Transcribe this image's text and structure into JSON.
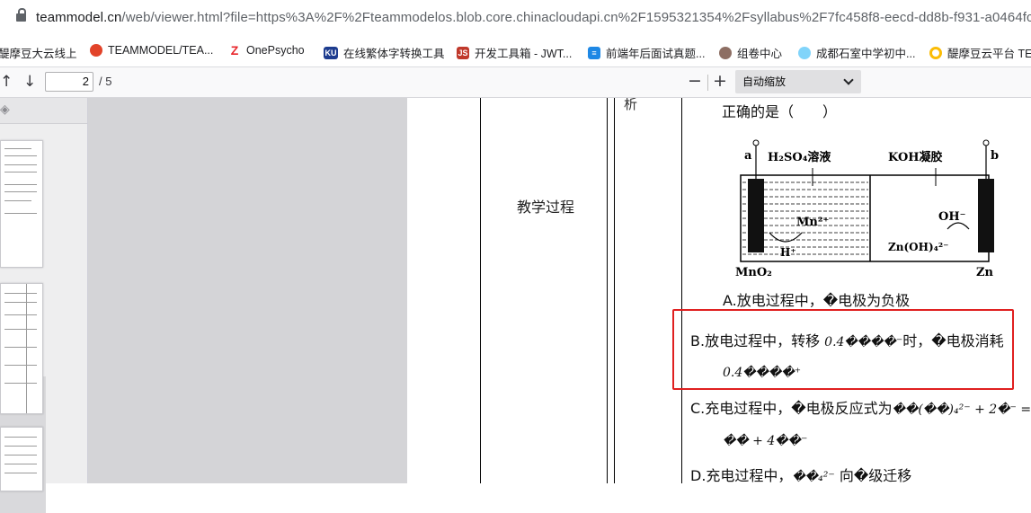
{
  "browser": {
    "url_host": "teammodel.cn",
    "url_rest": "/web/viewer.html?file=https%3A%2F%2Fteammodelos.blob.core.chinacloudapi.cn%2F1595321354%2Fsyllabus%2F7fc458f8-eecd-dd8b-f931-a0464fca1"
  },
  "bookmarks": [
    {
      "label": "醍摩豆大云线上",
      "icon": "",
      "color": "#1a73e8"
    },
    {
      "label": "TEAMMODEL/TEA...",
      "icon": "gitlab-icon",
      "color": "#e24329"
    },
    {
      "label": "OnePsycho",
      "icon": "z-logo-icon",
      "color": "#e8272c"
    },
    {
      "label": "在线繁体字转换工具",
      "icon": "KU",
      "color": "#1d3c8f"
    },
    {
      "label": "开发工具箱 - JWT...",
      "icon": "JS",
      "color": "#c0392b"
    },
    {
      "label": "前端年后面试真题...",
      "icon": "list-icon",
      "color": "#1e88e5"
    },
    {
      "label": "组卷中心",
      "icon": "owl-icon",
      "color": "#795548"
    },
    {
      "label": "成都石室中学初中...",
      "icon": "cloud-icon",
      "color": "#4fc3f7"
    },
    {
      "label": "醍摩豆云平台 TE",
      "icon": "ring-icon",
      "color": "#fbbc05"
    }
  ],
  "pdf": {
    "page_current": "2",
    "page_total": "/ 5",
    "zoom_label": "自动缩放"
  },
  "document": {
    "row_label": "教学过程",
    "col_fragment": "析",
    "question_tail": "正确的是（　　）",
    "diagram": {
      "a": "a",
      "b": "b",
      "left_solution": "H₂SO₄溶液",
      "right_solution": "KOH凝胶",
      "mn_ion": "Mn²⁺",
      "h_ion": "H⁺",
      "oh_ion": "OH⁻",
      "zn_complex": "Zn(OH)₄²⁻",
      "left_electrode": "MnO₂",
      "right_electrode": "Zn"
    },
    "option_a": "A.放电过程中，�电极为负极",
    "option_b_1": "B.放电过程中，转移",
    "option_b_1_math": "0.4����⁻",
    "option_b_1_end": "时，�电极消耗",
    "option_b_2_math": "0.4����⁺",
    "option_c_1": "C.充电过程中，�电极反应式为",
    "option_c_1_math": "��(��)₄²⁻ + 2�⁻ =",
    "option_c_2_math": "�� + 4��⁻",
    "option_d": "D.充电过程中，",
    "option_d_math": "��₄²⁻",
    "option_d_end": "向�级迁移"
  }
}
